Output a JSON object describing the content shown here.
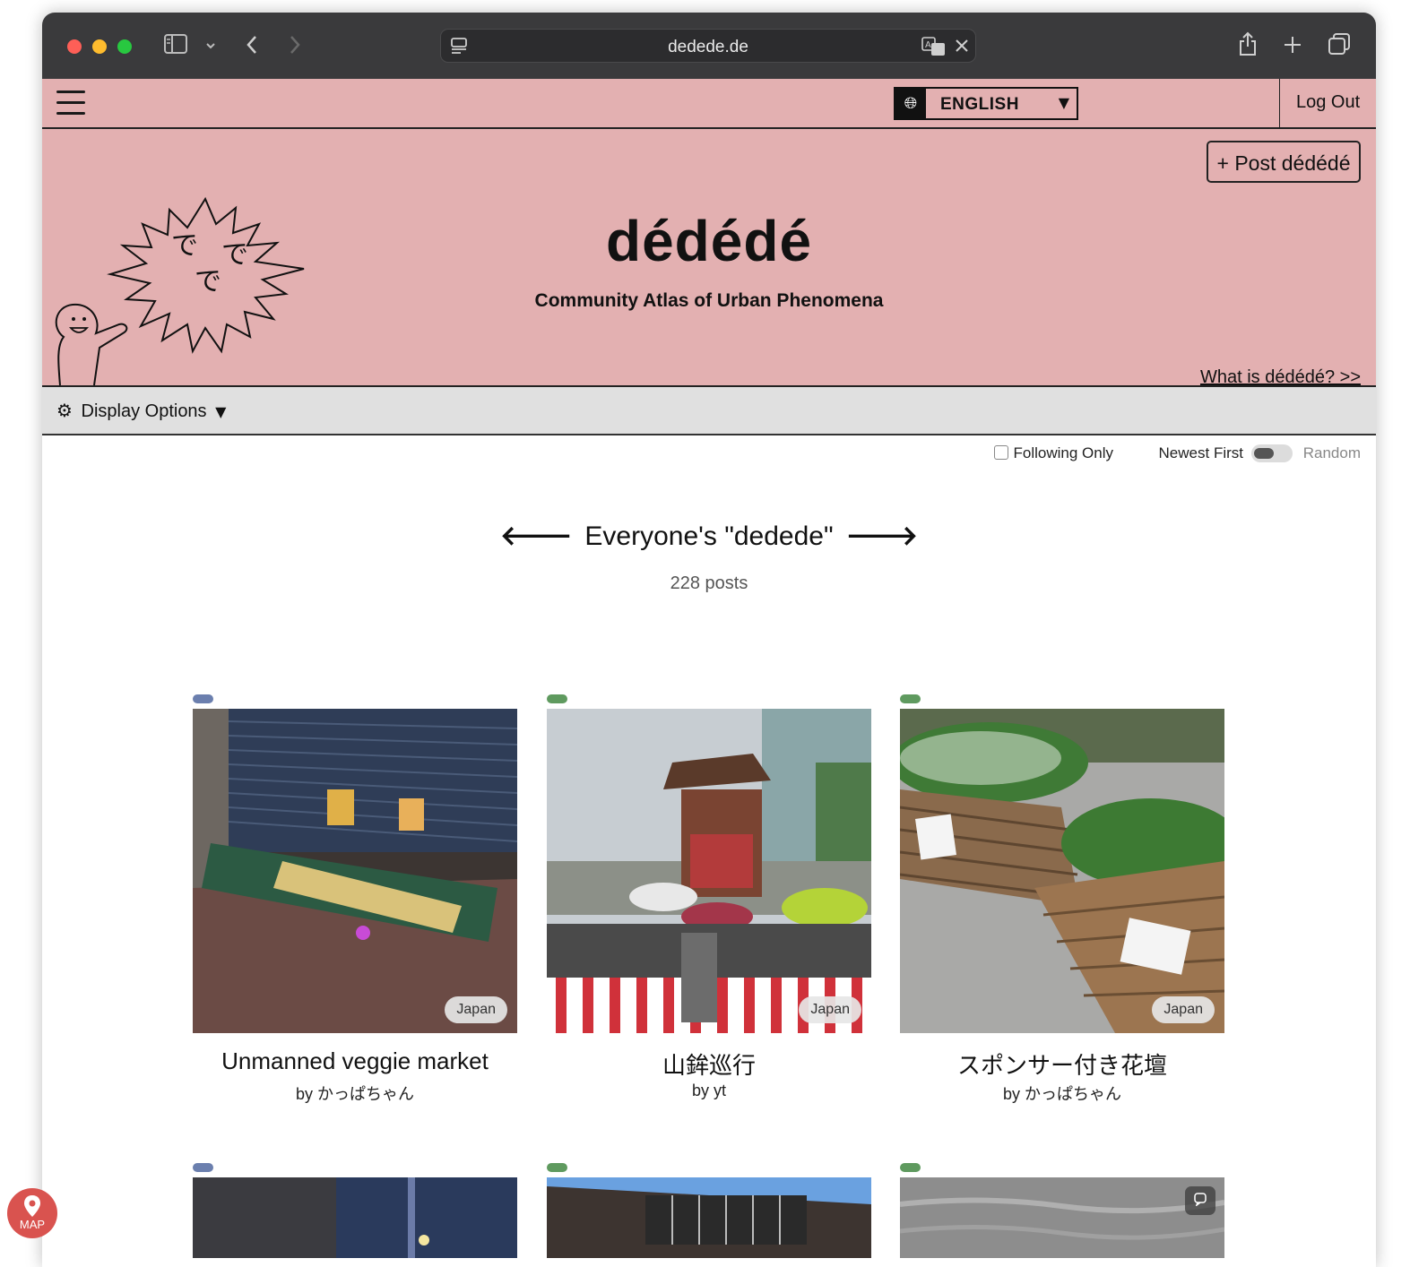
{
  "browser": {
    "url": "dedede.de"
  },
  "nav": {
    "language": "ENGLISH",
    "logout_label": "Log Out"
  },
  "header": {
    "post_button": "+ Post dédédé",
    "title": "dédédé",
    "subtitle": "Community Atlas of Urban Phenomena",
    "mascot_text": [
      "で",
      "で",
      "で"
    ],
    "what_link": "What is dédédé? >>"
  },
  "display_options": {
    "label": "Display Options"
  },
  "filters": {
    "following_only": "Following Only",
    "following_checked": false,
    "newest_first": "Newest First",
    "random": "Random"
  },
  "feed": {
    "title": "Everyone's \"dedede\"",
    "post_count": "228 posts"
  },
  "posts": [
    {
      "title": "Unmanned veggie market",
      "author": "by かっぱちゃん",
      "country": "Japan",
      "pill_color": "#6b7fae"
    },
    {
      "title": "山鉾巡行",
      "author": "by yt",
      "country": "Japan",
      "pill_color": "#5f9a5f"
    },
    {
      "title": "スポンサー付き花壇",
      "author": "by かっぱちゃん",
      "country": "Japan",
      "pill_color": "#5f9a5f"
    },
    {
      "pill_color": "#6b7fae"
    },
    {
      "pill_color": "#5f9a5f"
    },
    {
      "pill_color": "#5f9a5f"
    }
  ],
  "map_button": {
    "label": "MAP"
  },
  "colors": {
    "header_bg": "#e3b0b1",
    "display_bar_bg": "#e0e0e0",
    "map_button": "#d9534f"
  }
}
